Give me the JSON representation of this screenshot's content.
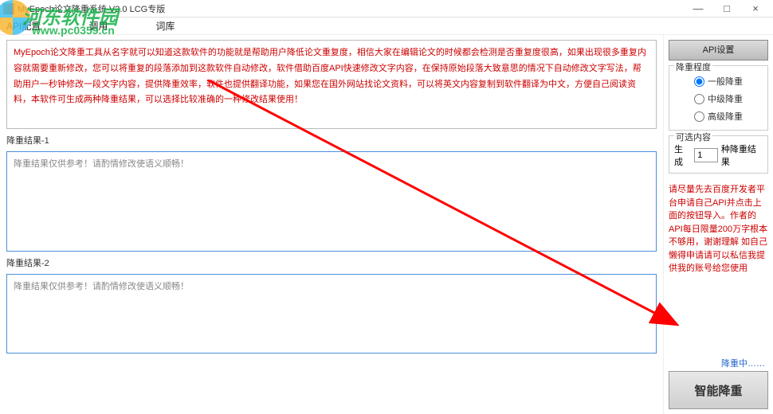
{
  "window": {
    "title": "MyEpoch论文降重系统 V2.0 LCG专版"
  },
  "menubar": {
    "item1": "API配置",
    "item2": "调用",
    "item3": "词库"
  },
  "intro": "MyEpoch论文降重工具从名字就可以知道这款软件的功能就是帮助用户降低论文重复度，相信大家在编辑论文的时候都会检测是否重复度很高，如果出现很多重复内容就需要重新修改，您可以将重复的段落添加到这款软件自动修改，软件借助百度API快速修改文字内容，在保持原始段落大致意思的情况下自动修改文字写法，帮助用户一秒钟修改一段文字内容，提供降重效率，软件也提供翻译功能，如果您在国外网站找论文资料，可以将英文内容复制到软件翻译为中文，方便自己阅读资料，本软件可生成两种降重结果，可以选择比较准确的一种修改结果使用！",
  "result1": {
    "label": "降重结果-1",
    "placeholder": "降重结果仅供参考！请酌情修改使语义顺畅！"
  },
  "result2": {
    "label": "降重结果-2",
    "placeholder": "降重结果仅供参考！请酌情修改使语义顺畅！"
  },
  "sidebar": {
    "api_btn": "API设置",
    "level_legend": "降重程度",
    "level1": "一般降重",
    "level2": "中级降重",
    "level3": "高级降重",
    "opt_legend": "可选内容",
    "gen_prefix": "生成",
    "gen_value": "1",
    "gen_suffix": "种降重结果",
    "note": "请尽量先去百度开发者平台申请自己API并点击上面的按钮导入。作者的API每日限量200万字根本不够用，谢谢理解\n如自己懒得申请请可以私信我提供我的账号给您使用",
    "status": "降重中……",
    "action": "智能降重"
  },
  "watermark": {
    "text": "河东软件园",
    "url": "www.pc0359.cn"
  }
}
